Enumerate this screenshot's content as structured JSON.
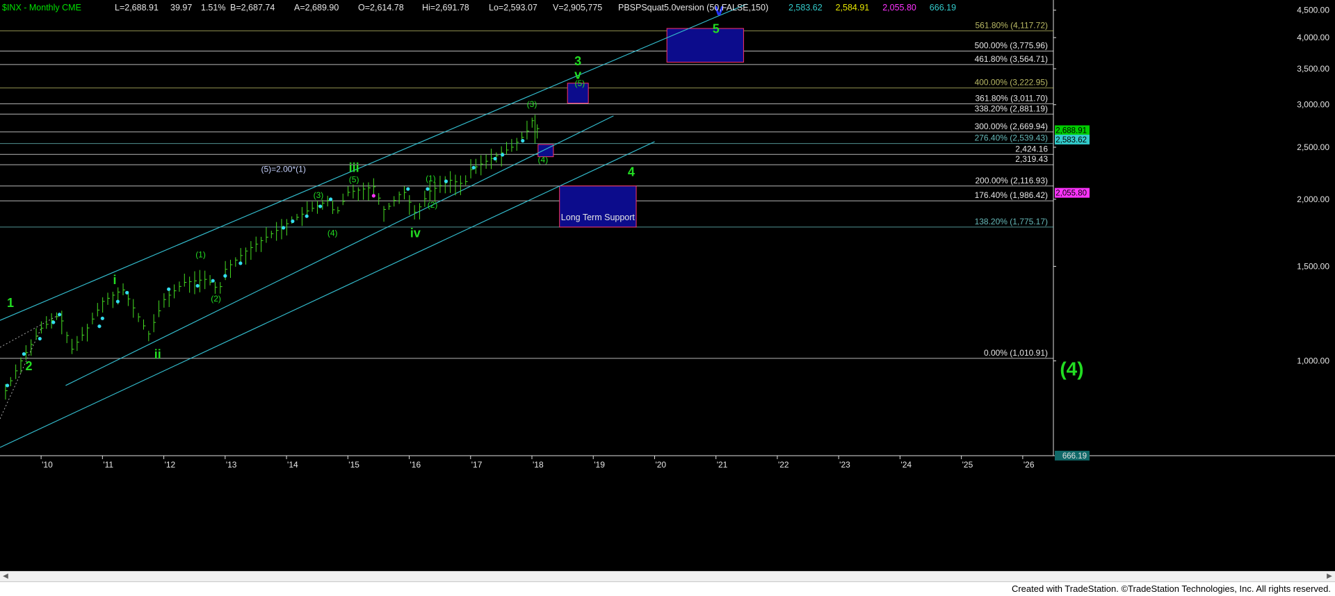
{
  "header": {
    "symbol": "$INX - Monthly  CME",
    "fields": [
      "L=2,688.91",
      "39.97",
      "1.51%",
      "B=2,687.74",
      "A=2,689.90",
      "O=2,614.78",
      "Hi=2,691.78",
      "Lo=2,593.07",
      "V=2,905,775",
      "PBSPSquat5.0version (50,FALSE,150)"
    ],
    "indicator_values": [
      {
        "text": "2,583.62",
        "color": "#33cccc"
      },
      {
        "text": "2,584.91",
        "color": "#e6e600"
      },
      {
        "text": "2,055.80",
        "color": "#ff33ff"
      },
      {
        "text": "666.19",
        "color": "#33cccc"
      }
    ]
  },
  "footer": {
    "text": "Created with TradeStation. ©TradeStation Technologies, Inc. All rights reserved."
  },
  "chart_data": {
    "type": "line",
    "x_ticks": [
      "'10",
      "'11",
      "'12",
      "'13",
      "'14",
      "'15",
      "'16",
      "'17",
      "'18",
      "'19",
      "'20",
      "'21",
      "'22",
      "'23",
      "'24",
      "'25",
      "'26"
    ],
    "y_ticks": [
      {
        "value": 1000,
        "label": "1,000.00"
      },
      {
        "value": 1500,
        "label": "1,500.00"
      },
      {
        "value": 2000,
        "label": "2,000.00"
      },
      {
        "value": 2500,
        "label": "2,500.00"
      },
      {
        "value": 3000,
        "label": "3,000.00"
      },
      {
        "value": 3500,
        "label": "3,500.00"
      },
      {
        "value": 4000,
        "label": "4,000.00"
      },
      {
        "value": 4500,
        "label": "4,500.00"
      }
    ],
    "y_scale": "log",
    "xlim": [
      2009.33,
      2026.5
    ],
    "ylim": [
      666,
      4700
    ],
    "price_series": {
      "name": "$INX",
      "points": [
        [
          2009.42,
          880
        ],
        [
          2009.67,
          1000
        ],
        [
          2010.0,
          1150
        ],
        [
          2010.3,
          1220
        ],
        [
          2010.5,
          1050
        ],
        [
          2010.75,
          1150
        ],
        [
          2011.0,
          1290
        ],
        [
          2011.33,
          1360
        ],
        [
          2011.75,
          1120
        ],
        [
          2012.0,
          1300
        ],
        [
          2012.33,
          1400
        ],
        [
          2012.7,
          1420
        ],
        [
          2012.9,
          1350
        ],
        [
          2013.0,
          1480
        ],
        [
          2013.33,
          1600
        ],
        [
          2013.67,
          1700
        ],
        [
          2014.0,
          1800
        ],
        [
          2014.33,
          1900
        ],
        [
          2014.67,
          1990
        ],
        [
          2014.8,
          1870
        ],
        [
          2015.0,
          2060
        ],
        [
          2015.42,
          2110
        ],
        [
          2015.6,
          1900
        ],
        [
          2015.9,
          2080
        ],
        [
          2016.1,
          1880
        ],
        [
          2016.33,
          2070
        ],
        [
          2016.67,
          2170
        ],
        [
          2016.9,
          2130
        ],
        [
          2017.0,
          2270
        ],
        [
          2017.33,
          2380
        ],
        [
          2017.67,
          2500
        ],
        [
          2017.9,
          2650
        ],
        [
          2018.05,
          2872
        ],
        [
          2018.1,
          2650
        ],
        [
          2018.15,
          2690
        ]
      ]
    },
    "fib_levels": [
      {
        "label": "561.80% (4,117.72)",
        "value": 4117.72,
        "color": "#b8b864"
      },
      {
        "label": "500.00% (3,775.96)",
        "value": 3775.96,
        "color": "#e6e6e6"
      },
      {
        "label": "461.80% (3,564.71)",
        "value": 3564.71,
        "color": "#e6e6e6"
      },
      {
        "label": "400.00% (3,222.95)",
        "value": 3222.95,
        "color": "#b8b864"
      },
      {
        "label": "361.80% (3,011.70)",
        "value": 3011.7,
        "color": "#e6e6e6"
      },
      {
        "label": "338.20% (2,881.19)",
        "value": 2881.19,
        "color": "#e6e6e6"
      },
      {
        "label": "300.00% (2,669.94)",
        "value": 2669.94,
        "color": "#e6e6e6"
      },
      {
        "label": "276.40% (2,539.43)",
        "value": 2539.43,
        "color": "#66b8b8"
      },
      {
        "label": "2,424.16",
        "value": 2424.16,
        "color": "#e6e6e6"
      },
      {
        "label": "2,319.43",
        "value": 2319.43,
        "color": "#e6e6e6"
      },
      {
        "label": "200.00% (2,116.93)",
        "value": 2116.93,
        "color": "#e6e6e6"
      },
      {
        "label": "176.40% (1,986.42)",
        "value": 1986.42,
        "color": "#e6e6e6"
      },
      {
        "label": "138.20% (1,775.17)",
        "value": 1775.17,
        "color": "#66b8b8"
      },
      {
        "label": "0.00% (1,010.91)",
        "value": 1010.91,
        "color": "#e6e6e6"
      }
    ],
    "price_badges": [
      {
        "text": "2,688.91",
        "value": 2688.91,
        "bg": "#00cc00",
        "fg": "#000000"
      },
      {
        "text": "2,583.62",
        "value": 2583.62,
        "bg": "#33cccc",
        "fg": "#000000"
      },
      {
        "text": "2,055.80",
        "value": 2055.8,
        "bg": "#ff33ff",
        "fg": "#000000"
      },
      {
        "text": "666.19",
        "value": 666.19,
        "bg": "#106868",
        "fg": "#e0e0e0"
      }
    ],
    "channel_lines": [
      {
        "from": [
          2009.33,
          1190
        ],
        "to": [
          2021.5,
          4620
        ]
      },
      {
        "from": [
          2010.4,
          900
        ],
        "to": [
          2019.33,
          2860
        ]
      },
      {
        "from": [
          2009.33,
          690
        ],
        "to": [
          2020.0,
          2560
        ]
      }
    ],
    "target_boxes": [
      {
        "name": "wave-5-target",
        "x": [
          2020.2,
          2021.45
        ],
        "y": [
          3600,
          4160
        ],
        "label": ""
      },
      {
        "name": "wave-3-v-target",
        "x": [
          2018.58,
          2018.92
        ],
        "y": [
          3020,
          3290
        ],
        "label": ""
      },
      {
        "name": "wave-4-small-target",
        "x": [
          2018.1,
          2018.35
        ],
        "y": [
          2400,
          2530
        ],
        "label": ""
      },
      {
        "name": "long-term-support",
        "x": [
          2018.45,
          2019.7
        ],
        "y": [
          1775,
          2117
        ],
        "label": "Long Term Support"
      }
    ],
    "wave_labels": [
      {
        "text": "1",
        "x": 2009.5,
        "y": 1260,
        "color": "#22dd22",
        "size": 18,
        "bold": true
      },
      {
        "text": "2",
        "x": 2009.8,
        "y": 960,
        "color": "#22dd22",
        "size": 18,
        "bold": true
      },
      {
        "text": "i",
        "x": 2011.2,
        "y": 1390,
        "color": "#22dd22",
        "size": 18,
        "bold": true
      },
      {
        "text": "ii",
        "x": 2011.9,
        "y": 1010,
        "color": "#22dd22",
        "size": 18,
        "bold": true
      },
      {
        "text": "(1)",
        "x": 2012.6,
        "y": 1560,
        "color": "#22dd22",
        "size": 12,
        "bold": false
      },
      {
        "text": "(2)",
        "x": 2012.85,
        "y": 1290,
        "color": "#22dd22",
        "size": 12,
        "bold": false
      },
      {
        "text": "(3)",
        "x": 2014.52,
        "y": 2010,
        "color": "#22dd22",
        "size": 12,
        "bold": false
      },
      {
        "text": "(4)",
        "x": 2014.75,
        "y": 1710,
        "color": "#22dd22",
        "size": 12,
        "bold": false
      },
      {
        "text": "(5)=2.00*(1)",
        "x": 2013.95,
        "y": 2250,
        "color": "#c8d4ff",
        "size": 12,
        "bold": false
      },
      {
        "text": "iii",
        "x": 2015.1,
        "y": 2250,
        "color": "#22dd22",
        "size": 18,
        "bold": true
      },
      {
        "text": "(5)",
        "x": 2015.1,
        "y": 2150,
        "color": "#22dd22",
        "size": 12,
        "bold": false
      },
      {
        "text": "iv",
        "x": 2016.1,
        "y": 1700,
        "color": "#22dd22",
        "size": 18,
        "bold": true
      },
      {
        "text": "(1)",
        "x": 2016.35,
        "y": 2160,
        "color": "#22dd22",
        "size": 12,
        "bold": false
      },
      {
        "text": "(2)",
        "x": 2016.38,
        "y": 1930,
        "color": "#22dd22",
        "size": 12,
        "bold": false
      },
      {
        "text": "(3)",
        "x": 2018.0,
        "y": 2970,
        "color": "#22dd22",
        "size": 12,
        "bold": false
      },
      {
        "text": "(4)",
        "x": 2018.18,
        "y": 2340,
        "color": "#22dd22",
        "size": 12,
        "bold": false
      },
      {
        "text": "(5)",
        "x": 2018.78,
        "y": 3250,
        "color": "#22dd22",
        "size": 12,
        "bold": false
      },
      {
        "text": "v",
        "x": 2018.75,
        "y": 3350,
        "color": "#22dd22",
        "size": 18,
        "bold": true
      },
      {
        "text": "3",
        "x": 2018.75,
        "y": 3550,
        "color": "#22dd22",
        "size": 18,
        "bold": true
      },
      {
        "text": "4",
        "x": 2019.62,
        "y": 2210,
        "color": "#22dd22",
        "size": 18,
        "bold": true
      },
      {
        "text": "5",
        "x": 2021.0,
        "y": 4080,
        "color": "#22dd22",
        "size": 18,
        "bold": true
      },
      {
        "text": "v",
        "x": 2021.05,
        "y": 4400,
        "color": "#2233ff",
        "size": 24,
        "bold": true
      },
      {
        "text": "(4)",
        "x": 2026.8,
        "y": 940,
        "color": "#22dd22",
        "size": 28,
        "bold": true
      }
    ],
    "pivot_dots": [
      [
        2009.45,
        900
      ],
      [
        2009.72,
        1030
      ],
      [
        2009.98,
        1100
      ],
      [
        2010.2,
        1180
      ],
      [
        2010.3,
        1220
      ],
      [
        2010.95,
        1160
      ],
      [
        2011.0,
        1200
      ],
      [
        2011.25,
        1290
      ],
      [
        2011.4,
        1340
      ],
      [
        2012.08,
        1360
      ],
      [
        2012.55,
        1380
      ],
      [
        2012.8,
        1410
      ],
      [
        2013.0,
        1440
      ],
      [
        2013.25,
        1520
      ],
      [
        2013.95,
        1770
      ],
      [
        2014.1,
        1820
      ],
      [
        2014.33,
        1860
      ],
      [
        2014.55,
        1940
      ],
      [
        2014.72,
        2000
      ],
      [
        2015.98,
        2090
      ],
      [
        2016.3,
        2090
      ],
      [
        2016.6,
        2160
      ],
      [
        2017.05,
        2290
      ],
      [
        2017.4,
        2380
      ],
      [
        2017.52,
        2420
      ],
      [
        2017.85,
        2570
      ]
    ],
    "magenta_dots": [
      [
        2015.42,
        2030
      ]
    ]
  }
}
